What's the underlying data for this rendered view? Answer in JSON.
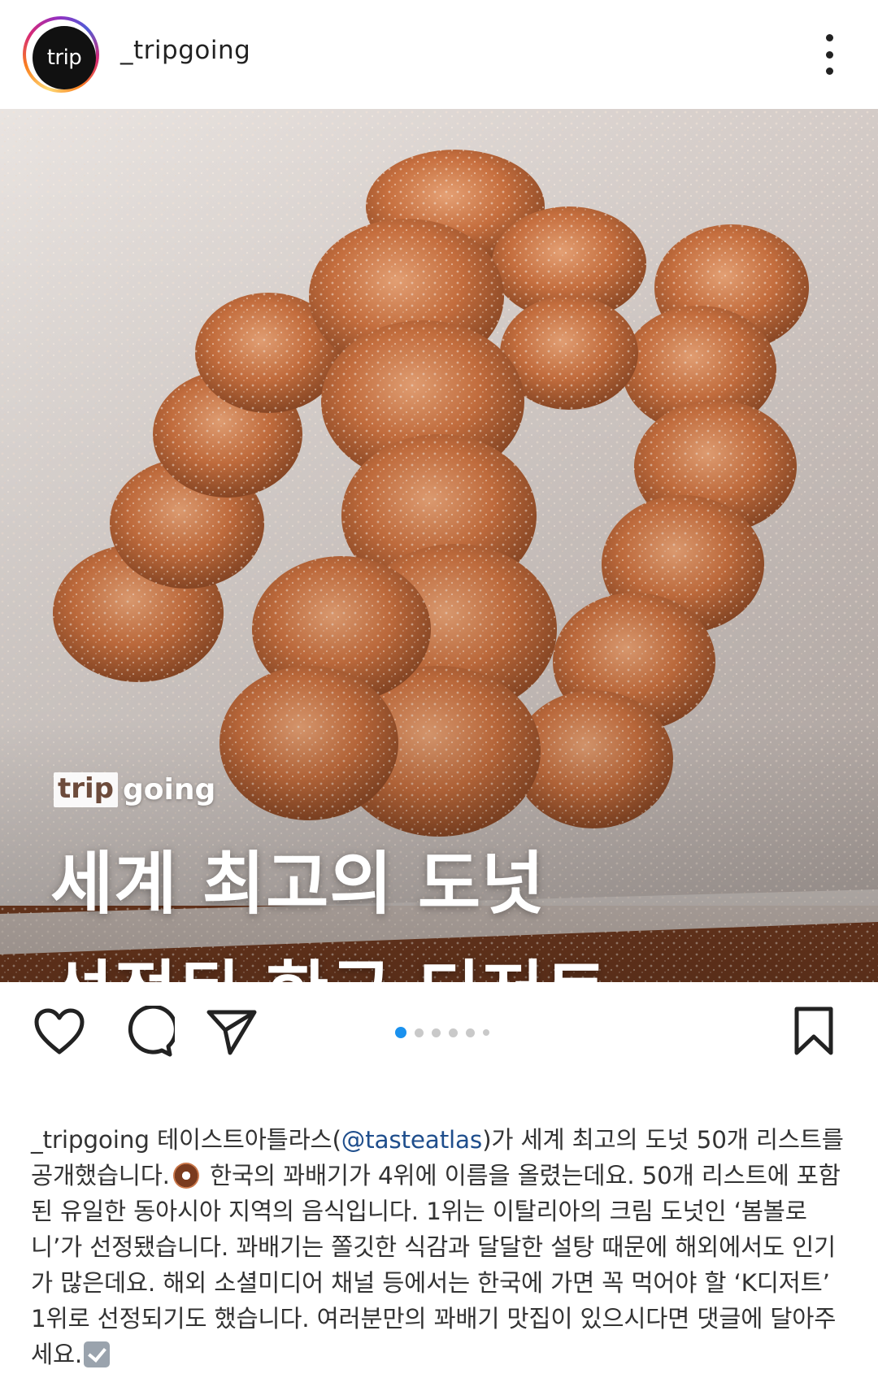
{
  "header": {
    "avatar_text": "trip",
    "username": "_tripgoing"
  },
  "post": {
    "brand_box": "trip",
    "brand_word": "going",
    "headline_line1": "세계 최고의 도넛",
    "headline_line2": "선정된 한국 디저트"
  },
  "actions": {
    "icons": [
      "heart-icon",
      "comment-icon",
      "share-icon",
      "bookmark-icon"
    ],
    "carousel_total": 6,
    "carousel_active": 1,
    "accent_color": "#1a91ee"
  },
  "caption": {
    "username": "_tripgoing",
    "part1": " 테이스트아틀라스(",
    "mention": "@tasteatlas",
    "part2": ")가 세계 최고의 도넛 50개 리스트를 공개했습니다.",
    "emoji1": "donut-emoji",
    "part3": " 한국의 꽈배기가 4위에 이름을 올렸는데요. 50개 리스트에 포함된 유일한 동아시아 지역의 음식입니다. 1위는 이탈리아의 크림 도넛인 ‘봄볼로니’가 선정됐습니다. 꽈배기는 쫄깃한 식감과 달달한 설탕 때문에 해외에서도 인기가 많은데요. 해외 소셜미디어 채널 등에서는 한국에 가면 꼭 먹어야 할 ‘K디저트’ 1위로 선정되기도 했습니다. 여러분만의 꽈배기 맛집이 있으시다면 댓글에 달아주세요.",
    "emoji2": "check-mark-emoji"
  }
}
